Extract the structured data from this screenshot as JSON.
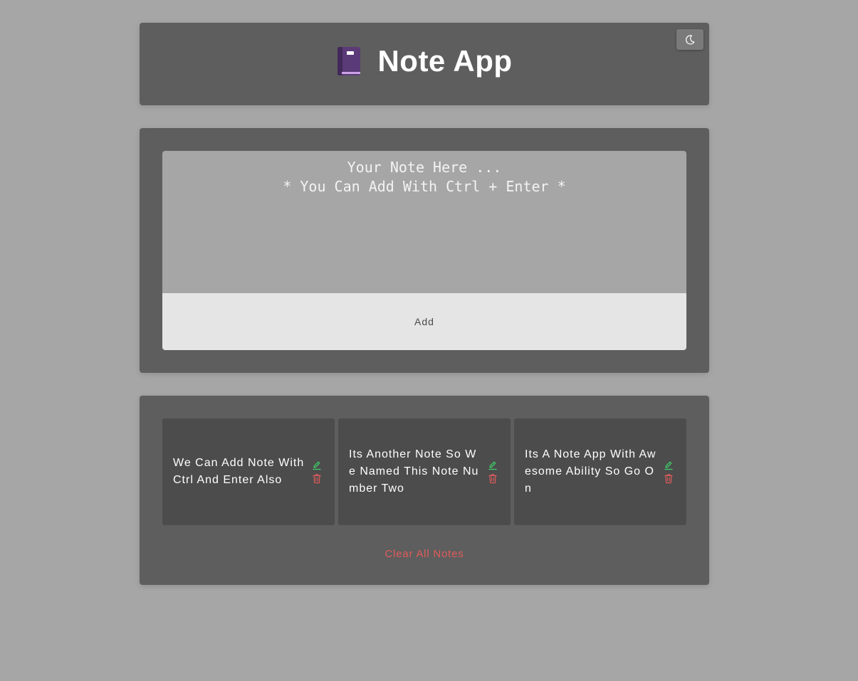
{
  "header": {
    "title": "Note App",
    "theme_toggle_icon": "moon-icon",
    "logo_icon": "notebook-icon"
  },
  "composer": {
    "placeholder_line1": "Your Note Here ...",
    "placeholder_line2": "* You Can Add With Ctrl + Enter *",
    "value": "",
    "add_label": "Add"
  },
  "notes": [
    {
      "text": "We Can Add Note With Ctrl And Enter Also",
      "edit_icon": "pencil-icon",
      "delete_icon": "trash-icon"
    },
    {
      "text": "Its Another Note So We Named This Note Number Two",
      "edit_icon": "pencil-icon",
      "delete_icon": "trash-icon"
    },
    {
      "text": "Its A Note App With Awesome Ability So Go On",
      "edit_icon": "pencil-icon",
      "delete_icon": "trash-icon"
    }
  ],
  "clear_all_label": "Clear All Notes",
  "colors": {
    "background": "#a6a6a6",
    "panel": "#5e5e5e",
    "note_card": "#4c4c4c",
    "edit": "#3dd66b",
    "delete": "#e05b5b"
  }
}
